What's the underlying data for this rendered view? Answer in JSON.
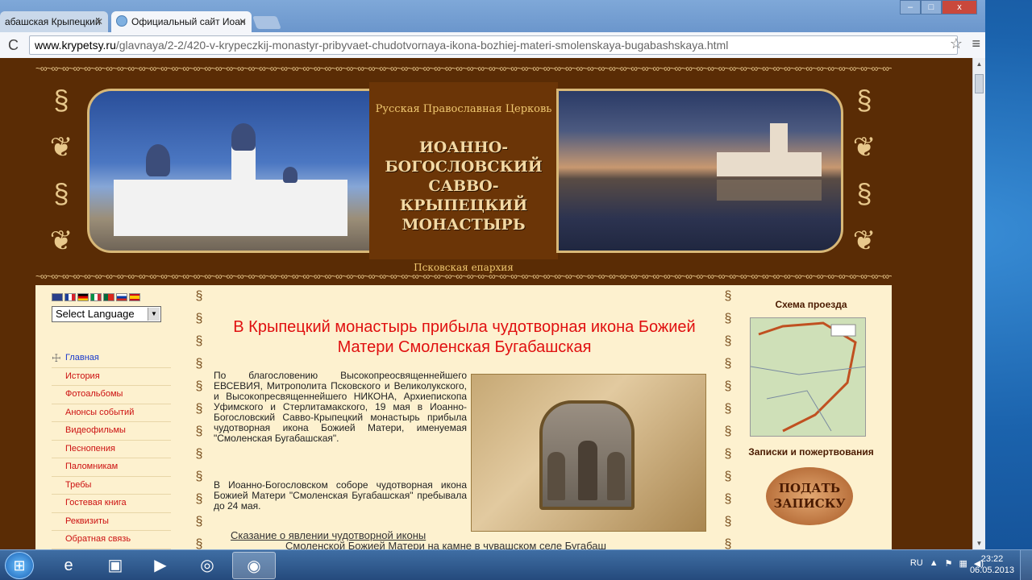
{
  "browser": {
    "tabs": [
      {
        "label": "абашская Крыпецкий"
      },
      {
        "label": "Официальный сайт Иоан"
      }
    ],
    "url_host": "www.krypetsy.ru",
    "url_path": "/glavnaya/2-2/420-v-krypeczkij-monastyr-pribyvaet-chudotvornaya-ikona-bozhiej-materi-smolenskaya-bugabashskaya.html",
    "window_controls": {
      "minimize": "–",
      "maximize": "□",
      "close": "x"
    }
  },
  "header": {
    "church_label": "Русская Православная Церковь",
    "title_line1": "ИОАННО-БОГОСЛОВСКИЙ",
    "title_line2": "САВВО-КРЫПЕЦКИЙ",
    "title_line3": "МОНАСТЫРЬ",
    "eparchy": "Псковская епархия"
  },
  "language": {
    "select_label": "Select Language"
  },
  "nav": {
    "items": [
      {
        "label": "Главная"
      },
      {
        "label": "История"
      },
      {
        "label": "Фотоальбомы"
      },
      {
        "label": "Анонсы событий"
      },
      {
        "label": "Видеофильмы"
      },
      {
        "label": "Песнопения"
      },
      {
        "label": "Паломникам"
      },
      {
        "label": "Требы"
      },
      {
        "label": "Гостевая книга"
      },
      {
        "label": "Реквизиты"
      },
      {
        "label": "Обратная связь"
      }
    ]
  },
  "article": {
    "headline_line1": "В Крыпецкий монастырь прибыла чудотворная икона Божией",
    "headline_line2": "Матери Смоленская Бугабашская",
    "para1": "По благословению Высокопреосвященнейшего ЕВСЕВИЯ, Митрополита Псковского и Великолукского, и Высокопресвященнейшего НИКОНА, Архиепископа Уфимского и Стерлитамакского, 19 мая в Иоанно-Богословский Савво-Крыпецкий монастырь прибыла чудотворная икона Божией Матери, именуемая \"Смоленская Бугабашская\".",
    "para2": "В Иоанно-Богословском соборе чудотворная икона Божией Матери \"Смоленская Бугабашская\" пребывала до 24 мая.",
    "legend_link": "Сказание о явлении чудотворной иконы",
    "legend_line2": "Смоленской Божией Матери на камне в чувашском селе Бугабаш"
  },
  "sidebar_right": {
    "map_title": "Схема проезда",
    "donations_title": "Записки и пожертвования",
    "submit_note": "ПОДАТЬ ЗАПИСКУ"
  },
  "taskbar": {
    "lang": "RU",
    "time": "23:22",
    "date": "06.05.2013"
  }
}
